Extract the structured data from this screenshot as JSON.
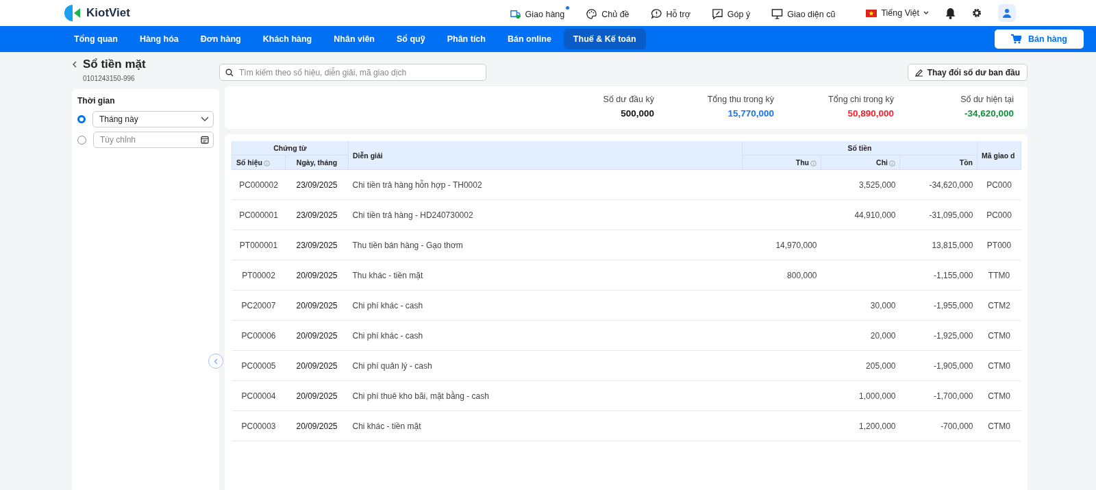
{
  "header": {
    "logo": "KiotViet",
    "links": [
      {
        "kind": "delivery",
        "label": "Giao hàng",
        "unread": true
      },
      {
        "kind": "theme",
        "label": "Chủ đề",
        "unread": false
      },
      {
        "kind": "support",
        "label": "Hỗ trợ",
        "unread": false
      },
      {
        "kind": "feedback",
        "label": "Góp ý",
        "unread": false
      },
      {
        "kind": "monitor",
        "label": "Giao diện cũ",
        "unread": false
      }
    ],
    "language": "Tiếng Việt"
  },
  "nav": {
    "items": [
      {
        "label": "Tổng quan",
        "selected": false
      },
      {
        "label": "Hàng hóa",
        "selected": false
      },
      {
        "label": "Đơn hàng",
        "selected": false
      },
      {
        "label": "Khách hàng",
        "selected": false
      },
      {
        "label": "Nhân viên",
        "selected": false
      },
      {
        "label": "Sổ quỹ",
        "selected": false
      },
      {
        "label": "Phân tích",
        "selected": false
      },
      {
        "label": "Bán online",
        "selected": false
      },
      {
        "label": "Thuế & Kế toán",
        "selected": true
      }
    ],
    "sell_button": "Bán hàng"
  },
  "page": {
    "title": "Sổ tiền mặt",
    "subtitle": "0101243150-996",
    "search": {
      "placeholder": "Tìm kiếm theo số hiệu, diễn giải, mã giao dịch"
    },
    "edit_button": "Thay đổi số dư ban đầu"
  },
  "filter": {
    "label": "Thời gian",
    "options": [
      {
        "kind": "select",
        "value": "Tháng này",
        "selected": true
      },
      {
        "kind": "date",
        "placeholder": "Tùy chỉnh",
        "selected": false
      }
    ]
  },
  "summary": [
    {
      "label": "Số dư đầu kỳ",
      "value": "500,000",
      "color": "#111111"
    },
    {
      "label": "Tổng thu trong kỳ",
      "value": "15,770,000",
      "color": "#1a73f0"
    },
    {
      "label": "Tổng chi trong kỳ",
      "value": "50,890,000",
      "color": "#f5222d"
    },
    {
      "label": "Số dư hiện tại",
      "value": "-34,620,000",
      "color": "#12903c"
    }
  ],
  "table": {
    "group_headers": [
      "Chứng từ",
      "Số tiền"
    ],
    "columns": [
      {
        "label": "Số hiệu",
        "info": true
      },
      {
        "label": "Ngày, tháng",
        "info": false
      },
      {
        "label": "Diễn giải",
        "info": false
      },
      {
        "label": "Thu",
        "info": true
      },
      {
        "label": "Chi",
        "info": true
      },
      {
        "label": "Tồn",
        "info": false
      },
      {
        "label": "Mã giao d",
        "info": false
      }
    ],
    "rows": [
      {
        "number": "PC000002",
        "date": "23/09/2025",
        "description": "Chi tiền trả hàng hỗn hợp - TH0002",
        "chi": "3,525,000",
        "balance": "-34,620,000",
        "code": "PC000"
      },
      {
        "number": "PC000001",
        "date": "23/09/2025",
        "description": "Chi tiền trả hàng - HD240730002",
        "chi": "44,910,000",
        "balance": "-31,095,000",
        "code": "PC000"
      },
      {
        "number": "PT000001",
        "date": "23/09/2025",
        "description": "Thu tiền bán hàng - Gạo thơm",
        "thu": "14,970,000",
        "balance": "13,815,000",
        "code": "PT000"
      },
      {
        "number": "PT00002",
        "date": "20/09/2025",
        "description": "Thu khác - tiền mặt",
        "thu": "800,000",
        "balance": "-1,155,000",
        "code": "TTM0"
      },
      {
        "number": "PC20007",
        "date": "20/09/2025",
        "description": "Chi phí khác - cash",
        "chi": "30,000",
        "balance": "-1,955,000",
        "code": "CTM2"
      },
      {
        "number": "PC00006",
        "date": "20/09/2025",
        "description": "Chi phí khác - cash",
        "chi": "20,000",
        "balance": "-1,925,000",
        "code": "CTM0"
      },
      {
        "number": "PC00005",
        "date": "20/09/2025",
        "description": "Chi phí quản lý - cash",
        "chi": "205,000",
        "balance": "-1,905,000",
        "code": "CTM0"
      },
      {
        "number": "PC00004",
        "date": "20/09/2025",
        "description": "Chi phí thuê kho bãi, mặt bằng - cash",
        "chi": "1,000,000",
        "balance": "-1,700,000",
        "code": "CTM0"
      },
      {
        "number": "PC00003",
        "date": "20/09/2025",
        "description": "Chi khác - tiền mặt",
        "chi": "1,200,000",
        "balance": "-700,000",
        "code": "CTM0"
      }
    ]
  }
}
